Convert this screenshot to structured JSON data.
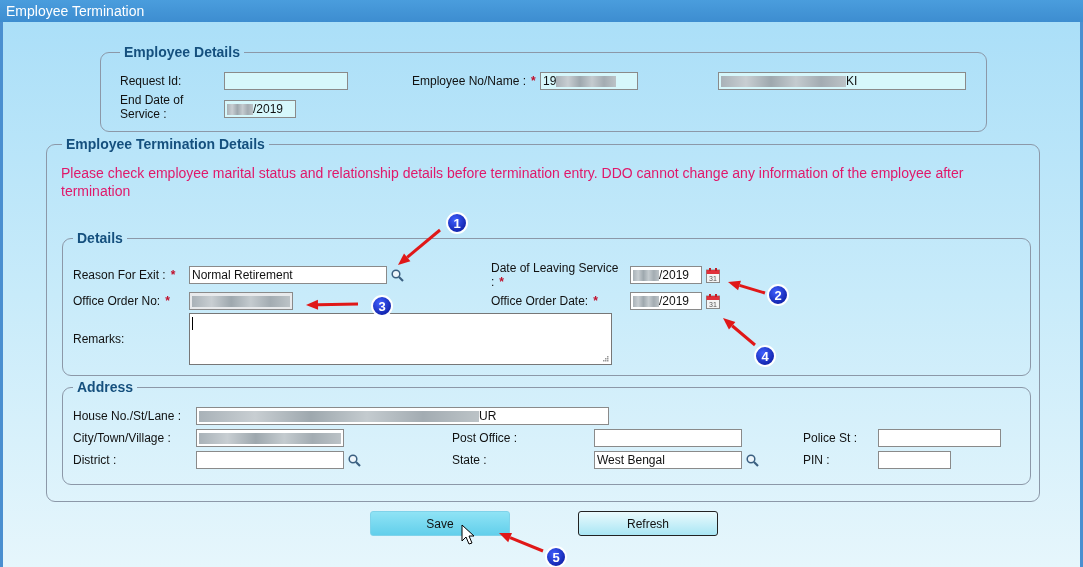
{
  "window": {
    "title": "Employee Termination"
  },
  "employee_details": {
    "legend": "Employee Details",
    "request_id": {
      "label": "Request Id:"
    },
    "employee_no": {
      "label": "Employee No/Name :",
      "required_mark": "*",
      "value": "19",
      "blur_trailing": true
    },
    "employee_name": {
      "value": "KI",
      "blur_leading": true
    },
    "end_date": {
      "label": "End Date of Service :",
      "value": "/2019",
      "blur_leading": true
    }
  },
  "termination": {
    "legend": "Employee Termination Details",
    "notice": "Please check employee marital status and relationship details before termination entry. DDO cannot change any information of the employee after termination",
    "details": {
      "legend": "Details",
      "reason": {
        "label": "Reason For Exit :",
        "required_mark": "*",
        "value": "Normal Retirement",
        "lookup": true
      },
      "leaving_date": {
        "label": "Date of Leaving Service :",
        "required_mark": "*",
        "value": "/2019",
        "blur_leading": true,
        "calendar_day": "31"
      },
      "order_no": {
        "label": "Office Order No:",
        "required_mark": "*",
        "blur_leading": true
      },
      "order_date": {
        "label": "Office Order Date:",
        "required_mark": "*",
        "value": "/2019",
        "blur_leading": true,
        "calendar_day": "31"
      },
      "remarks": {
        "label": "Remarks:",
        "focused": true
      }
    },
    "address": {
      "legend": "Address",
      "house": {
        "label": "House No./St/Lane :",
        "value": "UR",
        "blur_leading": true
      },
      "city": {
        "label": "City/Town/Village :",
        "blur_leading": true
      },
      "post_office": {
        "label": "Post Office :"
      },
      "police_station": {
        "label": "Police St :"
      },
      "district": {
        "label": "District :",
        "lookup": true
      },
      "state": {
        "label": "State :",
        "value": "West Bengal",
        "lookup": true
      },
      "pin": {
        "label": "PIN :"
      }
    }
  },
  "buttons": [
    {
      "label": "Save",
      "hovered": true
    },
    {
      "label": "Refresh",
      "hovered": false
    }
  ],
  "callouts": [
    {
      "number": "1"
    },
    {
      "number": "2"
    },
    {
      "number": "3"
    },
    {
      "number": "4"
    },
    {
      "number": "5"
    }
  ]
}
